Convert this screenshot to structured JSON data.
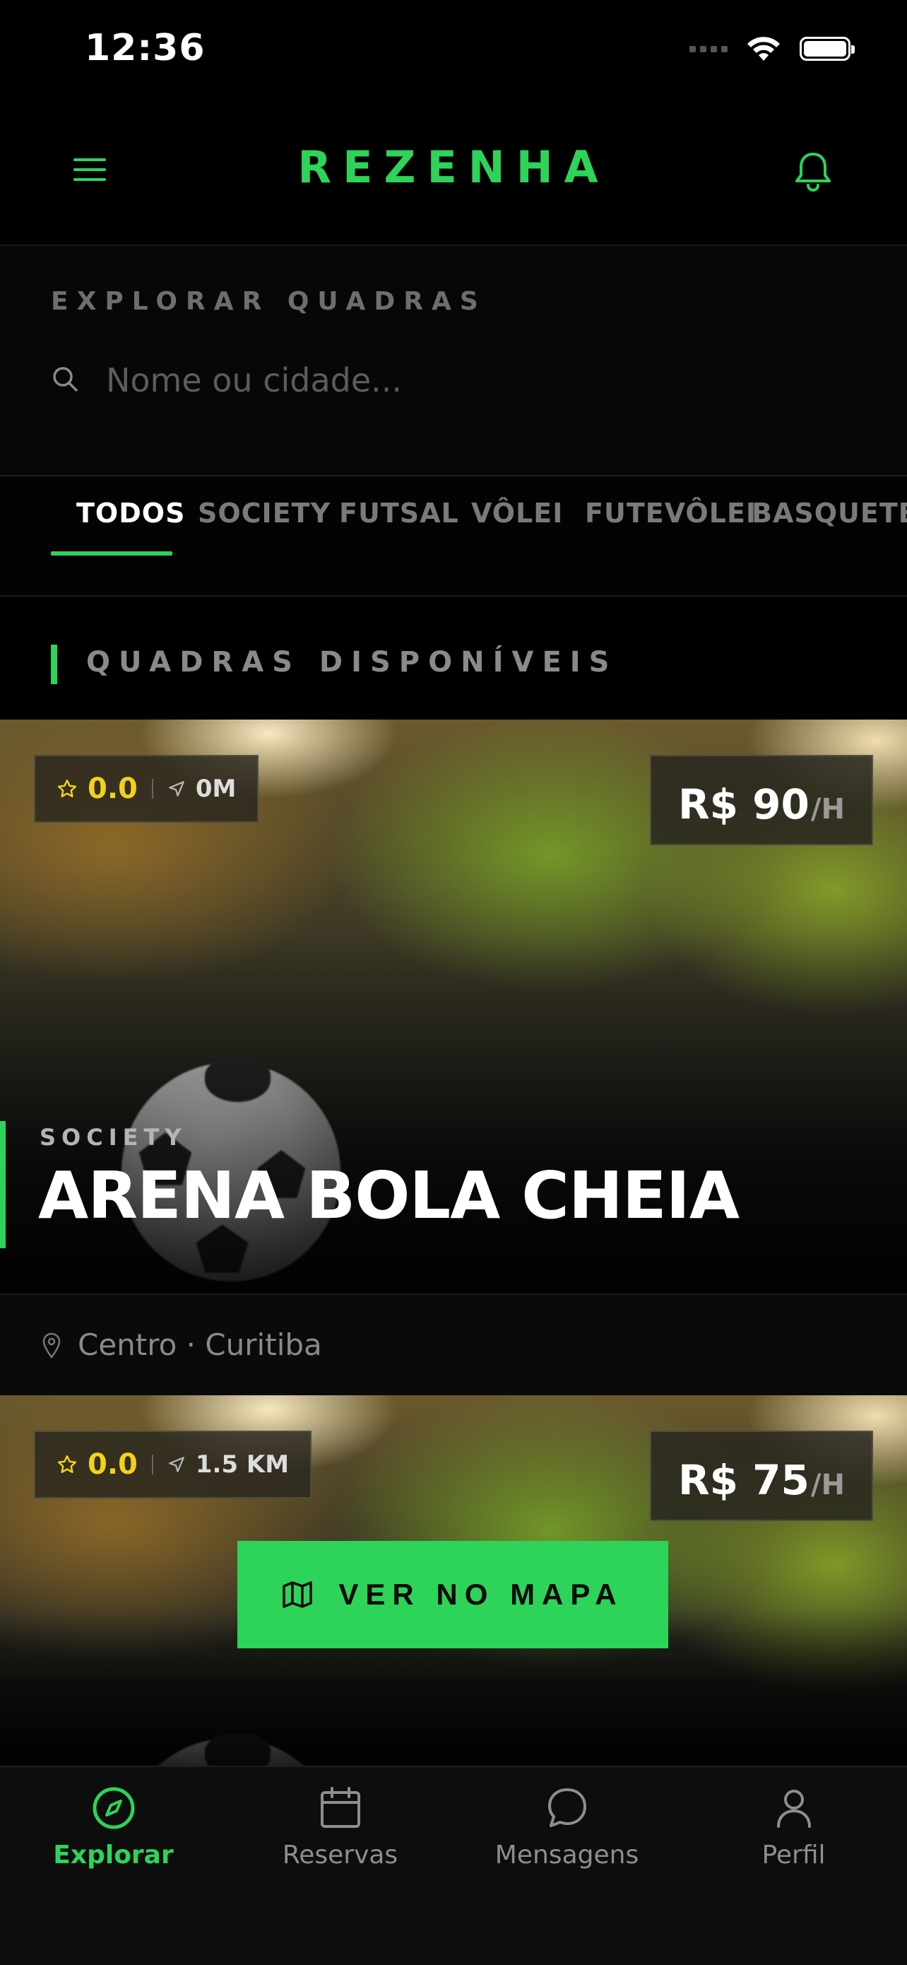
{
  "status_bar": {
    "time": "12:36"
  },
  "header": {
    "brand": "REZENHA"
  },
  "explore": {
    "label": "EXPLORAR QUADRAS",
    "search_placeholder": "Nome ou cidade..."
  },
  "tabs": [
    {
      "label": "TODOS",
      "active": true
    },
    {
      "label": "SOCIETY"
    },
    {
      "label": "FUTSAL"
    },
    {
      "label": "VÔLEI"
    },
    {
      "label": "FUTEVÔLEI"
    },
    {
      "label": "BASQUETE"
    }
  ],
  "section": {
    "title": "QUADRAS DISPONÍVEIS"
  },
  "cards": [
    {
      "rating": "0.0",
      "distance": "0M",
      "price": "R$ 90",
      "per": "/H",
      "type": "SOCIETY",
      "name": "ARENA BOLA CHEIA",
      "location": "Centro · Curitiba"
    },
    {
      "rating": "0.0",
      "distance": "1.5 KM",
      "price": "R$ 75",
      "per": "/H"
    }
  ],
  "map_button": {
    "label": "VER NO MAPA"
  },
  "bottom_nav": [
    {
      "label": "Explorar",
      "icon": "compass-icon",
      "active": true
    },
    {
      "label": "Reservas",
      "icon": "calendar-icon"
    },
    {
      "label": "Mensagens",
      "icon": "chat-bubble-icon"
    },
    {
      "label": "Perfil",
      "icon": "user-icon"
    }
  ],
  "colors": {
    "accent": "#2ed35a",
    "rating": "#f2d21a",
    "background": "#000000"
  }
}
